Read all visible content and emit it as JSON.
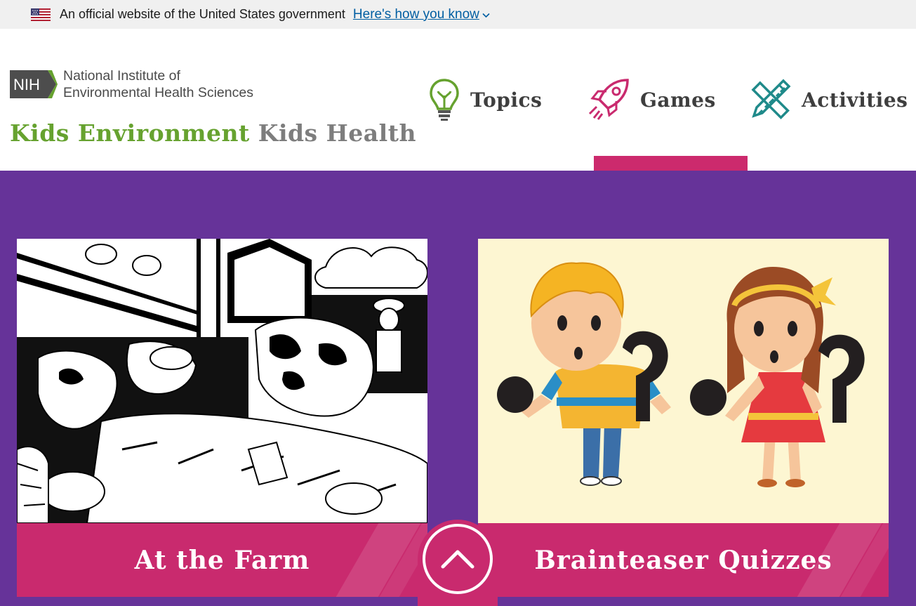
{
  "gov_banner": {
    "text": "An official website of the United States government",
    "link": "Here's how you know"
  },
  "header": {
    "nih_badge": "NIH",
    "nih_name_line1": "National Institute of",
    "nih_name_line2": "Environmental Health Sciences",
    "site_title_part1": "Kids Environment",
    "site_title_part2": "Kids Health"
  },
  "nav": {
    "items": [
      {
        "label": "Topics",
        "icon": "lightbulb-icon",
        "active": false
      },
      {
        "label": "Games",
        "icon": "rocket-icon",
        "active": true
      },
      {
        "label": "Activities",
        "icon": "ruler-pencil-icon",
        "active": false
      }
    ]
  },
  "cards": [
    {
      "title": "At the Farm",
      "image": "farm-coloring-illustration"
    },
    {
      "title": "Brainteaser Quizzes",
      "image": "kids-question-mark-illustration"
    }
  ],
  "colors": {
    "purple": "#663399",
    "magenta": "#c92a6e",
    "green": "#66a22f",
    "link_blue": "#005ea2"
  }
}
